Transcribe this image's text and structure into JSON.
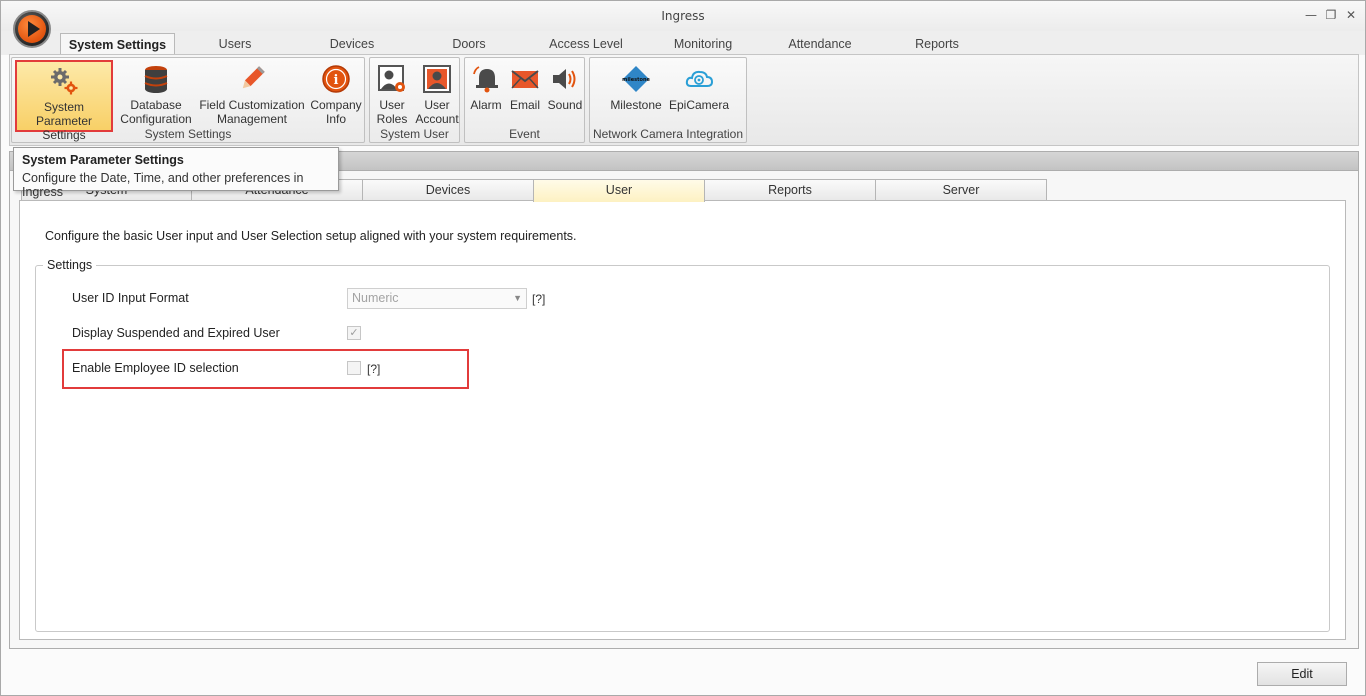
{
  "window": {
    "title": "Ingress"
  },
  "ribbon": {
    "tabs": [
      {
        "label": "System Settings"
      },
      {
        "label": "Users"
      },
      {
        "label": "Devices"
      },
      {
        "label": "Doors"
      },
      {
        "label": "Access Level"
      },
      {
        "label": "Monitoring"
      },
      {
        "label": "Attendance"
      },
      {
        "label": "Reports"
      }
    ],
    "groups": {
      "system_settings": {
        "label": "System Settings",
        "buttons": [
          {
            "line1": "System Parameter",
            "line2": "Settings",
            "icon": "gears-icon"
          },
          {
            "line1": "Database",
            "line2": "Configuration",
            "icon": "database-icon"
          },
          {
            "line1": "Field Customization",
            "line2": "Management",
            "icon": "pencil-icon"
          },
          {
            "line1": "Company",
            "line2": "Info",
            "icon": "info-icon"
          }
        ]
      },
      "system_user": {
        "label": "System User",
        "buttons": [
          {
            "line1": "User",
            "line2": "Roles",
            "icon": "user-roles-icon"
          },
          {
            "line1": "User",
            "line2": "Account",
            "icon": "user-account-icon"
          }
        ]
      },
      "event": {
        "label": "Event",
        "buttons": [
          {
            "line1": "Alarm",
            "icon": "alarm-bell-icon"
          },
          {
            "line1": "Email",
            "icon": "email-icon"
          },
          {
            "line1": "Sound",
            "icon": "speaker-icon"
          }
        ]
      },
      "network_camera": {
        "label": "Network Camera Integration",
        "buttons": [
          {
            "line1": "Milestone",
            "icon": "milestone-icon",
            "logo_text": "milestone"
          },
          {
            "line1": "EpiCamera",
            "icon": "cloud-camera-icon"
          }
        ]
      }
    }
  },
  "tooltip": {
    "title": "System Parameter Settings",
    "description": "Configure the Date, Time, and other preferences in Ingress"
  },
  "page_tabs": [
    {
      "label": "System"
    },
    {
      "label": "Attendance"
    },
    {
      "label": "Devices"
    },
    {
      "label": "User"
    },
    {
      "label": "Reports"
    },
    {
      "label": "Server"
    }
  ],
  "user_panel": {
    "intro": "Configure the basic User input and User Selection setup aligned with your system requirements.",
    "settings_legend": "Settings",
    "fields": {
      "user_id_input_format": {
        "label": "User ID Input Format",
        "value": "Numeric",
        "help": "[?]"
      },
      "display_suspended": {
        "label": "Display Suspended and Expired User",
        "checked": true
      },
      "enable_employee_id": {
        "label": "Enable Employee ID selection",
        "checked": false,
        "help": "[?]"
      }
    }
  },
  "footer": {
    "edit_label": "Edit"
  },
  "colors": {
    "highlight": "#e23b3b",
    "selected_button": "#f8d067",
    "accent_orange": "#e2540f"
  }
}
